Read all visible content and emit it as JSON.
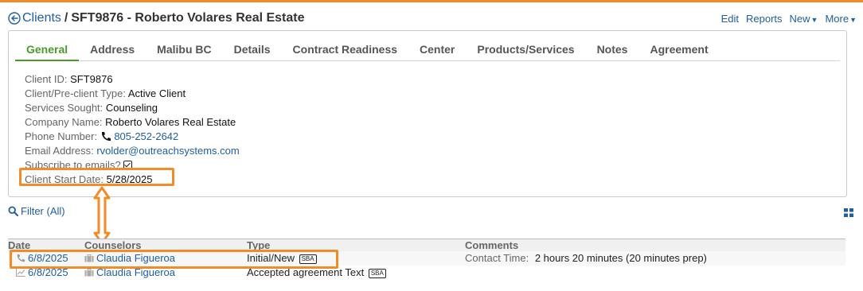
{
  "header": {
    "back_label": "Clients",
    "separator": "/",
    "title": "SFT9876 - Roberto Volares Real Estate",
    "actions": {
      "edit": "Edit",
      "reports": "Reports",
      "new": "New",
      "more": "More"
    }
  },
  "tabs": [
    {
      "label": "General",
      "active": true
    },
    {
      "label": "Address"
    },
    {
      "label": "Malibu BC"
    },
    {
      "label": "Details"
    },
    {
      "label": "Contract Readiness"
    },
    {
      "label": "Center"
    },
    {
      "label": "Products/Services"
    },
    {
      "label": "Notes"
    },
    {
      "label": "Agreement"
    }
  ],
  "fields": {
    "client_id": {
      "label": "Client ID:",
      "value": "SFT9876"
    },
    "client_type": {
      "label": "Client/Pre-client Type:",
      "value": "Active Client"
    },
    "services": {
      "label": "Services Sought:",
      "value": "Counseling"
    },
    "company": {
      "label": "Company Name:",
      "value": "Roberto Volares Real Estate"
    },
    "phone": {
      "label": "Phone Number:",
      "value": "805-252-2642"
    },
    "email": {
      "label": "Email Address:",
      "value": "rvolder@outreachsystems.com"
    },
    "subscribe": {
      "label": "Subscribe to emails?",
      "checked": true
    },
    "start_date": {
      "label": "Client Start Date:",
      "value": "5/28/2025"
    }
  },
  "filter": {
    "label": "Filter (All)"
  },
  "table": {
    "headers": {
      "date": "Date",
      "counselors": "Counselors",
      "type": "Type",
      "comments": "Comments"
    },
    "rows": [
      {
        "date": "6/8/2025",
        "icon": "phone-icon",
        "counselor": "Claudia Figueroa",
        "type": "Initial/New",
        "badge": "SBA",
        "comment_label": "Contact Time:",
        "comment_value": "2 hours 20 minutes (20 minutes prep)"
      },
      {
        "date": "6/8/2025",
        "icon": "trend-icon",
        "counselor": "Claudia Figueroa",
        "type": "Accepted agreement Text",
        "badge": "SBA",
        "comment_label": "",
        "comment_value": ""
      }
    ]
  },
  "colors": {
    "accent_orange": "#f28c28",
    "link_blue": "#1f5fa0",
    "tab_active_green": "#4a9a2b"
  }
}
